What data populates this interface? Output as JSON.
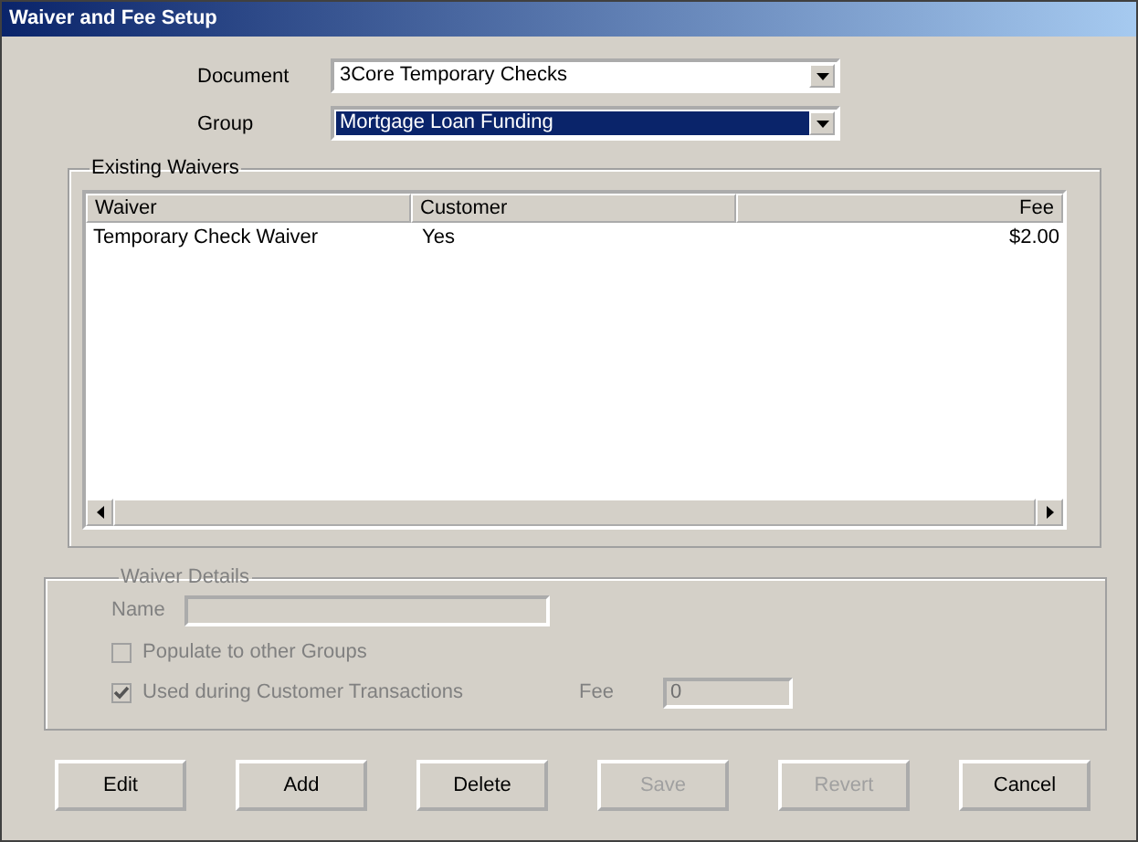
{
  "window": {
    "title": "Waiver and Fee Setup"
  },
  "document": {
    "label": "Document",
    "value": "3Core Temporary Checks",
    "focused": false
  },
  "group": {
    "label": "Group",
    "value": "Mortgage Loan Funding",
    "focused": true
  },
  "existing_waivers": {
    "title": "Existing Waivers",
    "columns": [
      "Waiver",
      "Customer",
      "Fee"
    ],
    "rows": [
      {
        "cells": [
          "Temporary Check Waiver",
          "Yes",
          "$2.00"
        ]
      }
    ]
  },
  "waiver_details": {
    "title": "Waiver Details",
    "disabled": true,
    "name": {
      "label": "Name"
    },
    "checkboxes": [
      {
        "label": "Populate to other Groups",
        "checked": false
      },
      {
        "label": "Used during Customer Transactions",
        "checked": true
      }
    ],
    "fee": {
      "label": "Fee",
      "value": "0"
    }
  },
  "buttons": [
    {
      "label": "Edit",
      "disabled": false
    },
    {
      "label": "Add",
      "disabled": false
    },
    {
      "label": "Delete",
      "disabled": false
    },
    {
      "label": "Save",
      "disabled": true
    },
    {
      "label": "Revert",
      "disabled": true
    },
    {
      "label": "Cancel",
      "disabled": false
    }
  ]
}
